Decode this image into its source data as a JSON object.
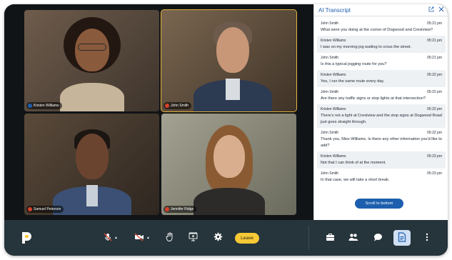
{
  "participants": [
    {
      "name": "Kristen Williams",
      "skin": "#8a5a3c",
      "hair": "#231711",
      "shirt": "#c6b59a",
      "bg": "#5b4c40",
      "speaking": false
    },
    {
      "name": "John Smith",
      "skin": "#c79778",
      "hair": "#6d5a4c",
      "shirt": "#2c3a52",
      "bg": "#6b5a47",
      "speaking": true
    },
    {
      "name": "Samuel Peterson",
      "skin": "#6b4430",
      "hair": "#1c1612",
      "shirt": "#3b5074",
      "bg": "#4b3d31",
      "speaking": false
    },
    {
      "name": "Jennifer Ridge",
      "skin": "#d8ae8e",
      "hair": "#8a5b33",
      "shirt": "#2d2b2a",
      "bg": "#8d8a7c",
      "speaking": false
    }
  ],
  "transcript": {
    "title": "AI Transcript",
    "messages": [
      {
        "speaker": "John Smith",
        "time": "05:21 pm",
        "text": "What were you doing at the corner of Dogwood and Crestview?"
      },
      {
        "speaker": "Kristen Williams",
        "time": "05:21 pm",
        "text": "I was on my morning jog waiting to cross the street."
      },
      {
        "speaker": "John Smith",
        "time": "05:21 pm",
        "text": "Is this a typical jogging route for you?"
      },
      {
        "speaker": "Kristen Williams",
        "time": "05:22 pm",
        "text": "Yes, I run the same route every day."
      },
      {
        "speaker": "John Smith",
        "time": "05:22 pm",
        "text": "Are there any traffic signs or stop lights at that intersection?"
      },
      {
        "speaker": "Kristen Williams",
        "time": "05:22 pm",
        "text": "There's not a light at Crestview and the stop signs at Dogwood Road just goes straight through."
      },
      {
        "speaker": "John Smith",
        "time": "05:22 pm",
        "text": "Thank you, Miss Williams. Is there any other information you'd like to add?"
      },
      {
        "speaker": "Kristen Williams",
        "time": "05:23 pm",
        "text": "Not that I can think of at the moment."
      },
      {
        "speaker": "John Smith",
        "time": "05:23 pm",
        "text": "In that case, we will take a short break."
      }
    ],
    "scroll_label": "Scroll to bottom"
  },
  "toolbar": {
    "leave_label": "Leave"
  },
  "colors": {
    "accent": "#1d5fae",
    "leave": "#f7c935",
    "speaking_outline": "#e3b341",
    "toolbar": "#26343b"
  }
}
